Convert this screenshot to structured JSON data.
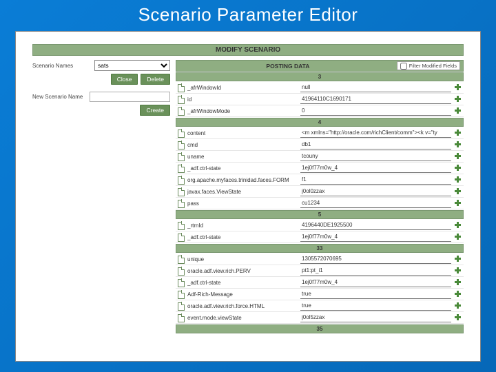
{
  "slide_title": "Scenario Parameter Editor",
  "header": "MODIFY SCENARIO",
  "left": {
    "scenario_names_label": "Scenario Names",
    "scenario_selected": "sats",
    "close_label": "Close",
    "delete_label": "Delete",
    "new_name_label": "New Scenario Name",
    "new_name_value": "",
    "create_label": "Create"
  },
  "posting": {
    "title": "POSTING DATA",
    "filter_label": "Filter Modified Fields"
  },
  "sections": [
    {
      "band": "3",
      "rows": [
        {
          "name": "_afrWindowId",
          "value": "null"
        },
        {
          "name": "id",
          "value": "41964110C1690171"
        },
        {
          "name": "_afrWindowMode",
          "value": "0"
        }
      ]
    },
    {
      "band": "4",
      "rows": [
        {
          "name": "content",
          "value": "<m xmlns=\"http://oracle.com/richClient/comm\"><k v=\"ty"
        },
        {
          "name": "cmd",
          "value": "db1"
        },
        {
          "name": "uname",
          "value": "tcouny"
        },
        {
          "name": "_adf.ctrl-state",
          "value": "1ej0f77m0w_4"
        },
        {
          "name": "org.apache.myfaces.trinidad.faces.FORM",
          "value": "f1"
        },
        {
          "name": "javax.faces.ViewState",
          "value": "j0ol0zzax"
        },
        {
          "name": "pass",
          "value": "cu1234"
        }
      ]
    },
    {
      "band": "5",
      "rows": [
        {
          "name": "_rtrnId",
          "value": "4196440DE1925500"
        },
        {
          "name": "_adf.ctrl-state",
          "value": "1ej0f77m0w_4"
        }
      ]
    },
    {
      "band": "33",
      "rows": [
        {
          "name": "unique",
          "value": "1305572070695"
        },
        {
          "name": "oracle.adf.view.rich.PERV",
          "value": "pt1:pt_i1"
        },
        {
          "name": "_adf.ctrl-state",
          "value": "1ej0f77m0w_4"
        },
        {
          "name": "Adf-Rich-Message",
          "value": "true"
        },
        {
          "name": "oracle.adf.view.rich.force.HTML",
          "value": "true"
        },
        {
          "name": "event.mode.viewState",
          "value": "j0ol5zzax"
        }
      ]
    },
    {
      "band": "35",
      "rows": []
    }
  ]
}
